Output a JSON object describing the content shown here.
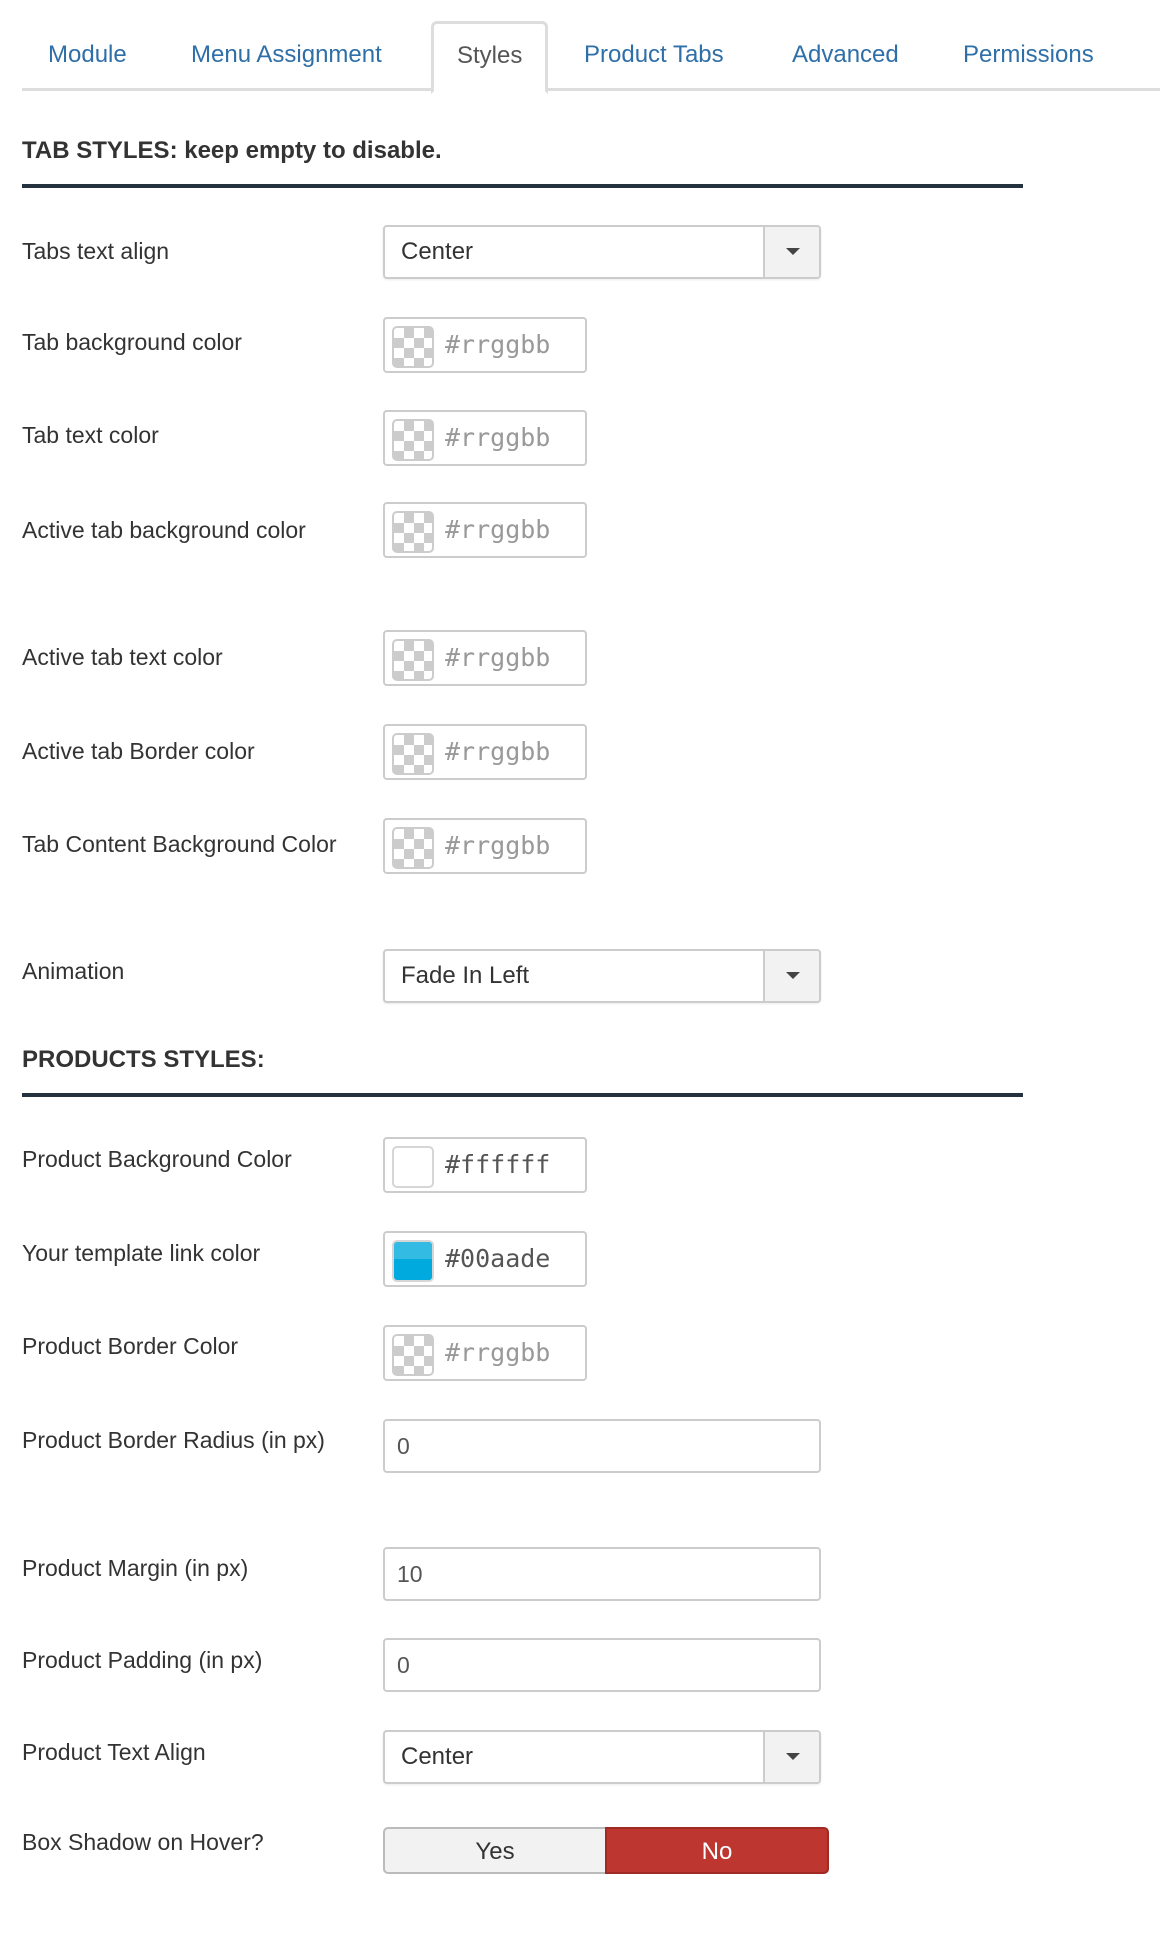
{
  "tabs": [
    {
      "label": "Module",
      "active": false
    },
    {
      "label": "Menu Assignment",
      "active": false
    },
    {
      "label": "Styles",
      "active": true
    },
    {
      "label": "Product Tabs",
      "active": false
    },
    {
      "label": "Advanced",
      "active": false
    },
    {
      "label": "Permissions",
      "active": false
    }
  ],
  "tab_styles": {
    "heading": "TAB STYLES: keep empty to disable.",
    "tabs_text_align": {
      "label": "Tabs text align",
      "value": "Center"
    },
    "tab_background_color": {
      "label": "Tab background color",
      "placeholder": "#rrggbb",
      "value": ""
    },
    "tab_text_color": {
      "label": "Tab text color",
      "placeholder": "#rrggbb",
      "value": ""
    },
    "active_tab_background_color": {
      "label": "Active tab background color",
      "placeholder": "#rrggbb",
      "value": ""
    },
    "active_tab_text_color": {
      "label": "Active tab text color",
      "placeholder": "#rrggbb",
      "value": ""
    },
    "active_tab_border_color": {
      "label": "Active tab Border color",
      "placeholder": "#rrggbb",
      "value": ""
    },
    "tab_content_background_color": {
      "label": "Tab Content Background Color",
      "placeholder": "#rrggbb",
      "value": ""
    },
    "animation": {
      "label": "Animation",
      "value": "Fade In Left"
    }
  },
  "products_styles": {
    "heading": "PRODUCTS STYLES:",
    "product_background_color": {
      "label": "Product Background Color",
      "value": "#ffffff",
      "swatch": "#ffffff"
    },
    "template_link_color": {
      "label": "Your template link color",
      "value": "#00aade",
      "swatch": "#00aade"
    },
    "product_border_color": {
      "label": "Product Border Color",
      "placeholder": "#rrggbb",
      "value": ""
    },
    "product_border_radius": {
      "label": "Product Border Radius (in px)",
      "value": "0"
    },
    "product_margin": {
      "label": "Product Margin (in px)",
      "value": "10"
    },
    "product_padding": {
      "label": "Product Padding (in px)",
      "value": "0"
    },
    "product_text_align": {
      "label": "Product Text Align",
      "value": "Center"
    },
    "box_shadow_on_hover": {
      "label": "Box Shadow on Hover?",
      "options": [
        "Yes",
        "No"
      ],
      "selected": "No"
    }
  },
  "colors": {
    "link": "#2f6fa8",
    "heading_rule": "#24313f",
    "toggle_no_active": "#bd362f"
  }
}
